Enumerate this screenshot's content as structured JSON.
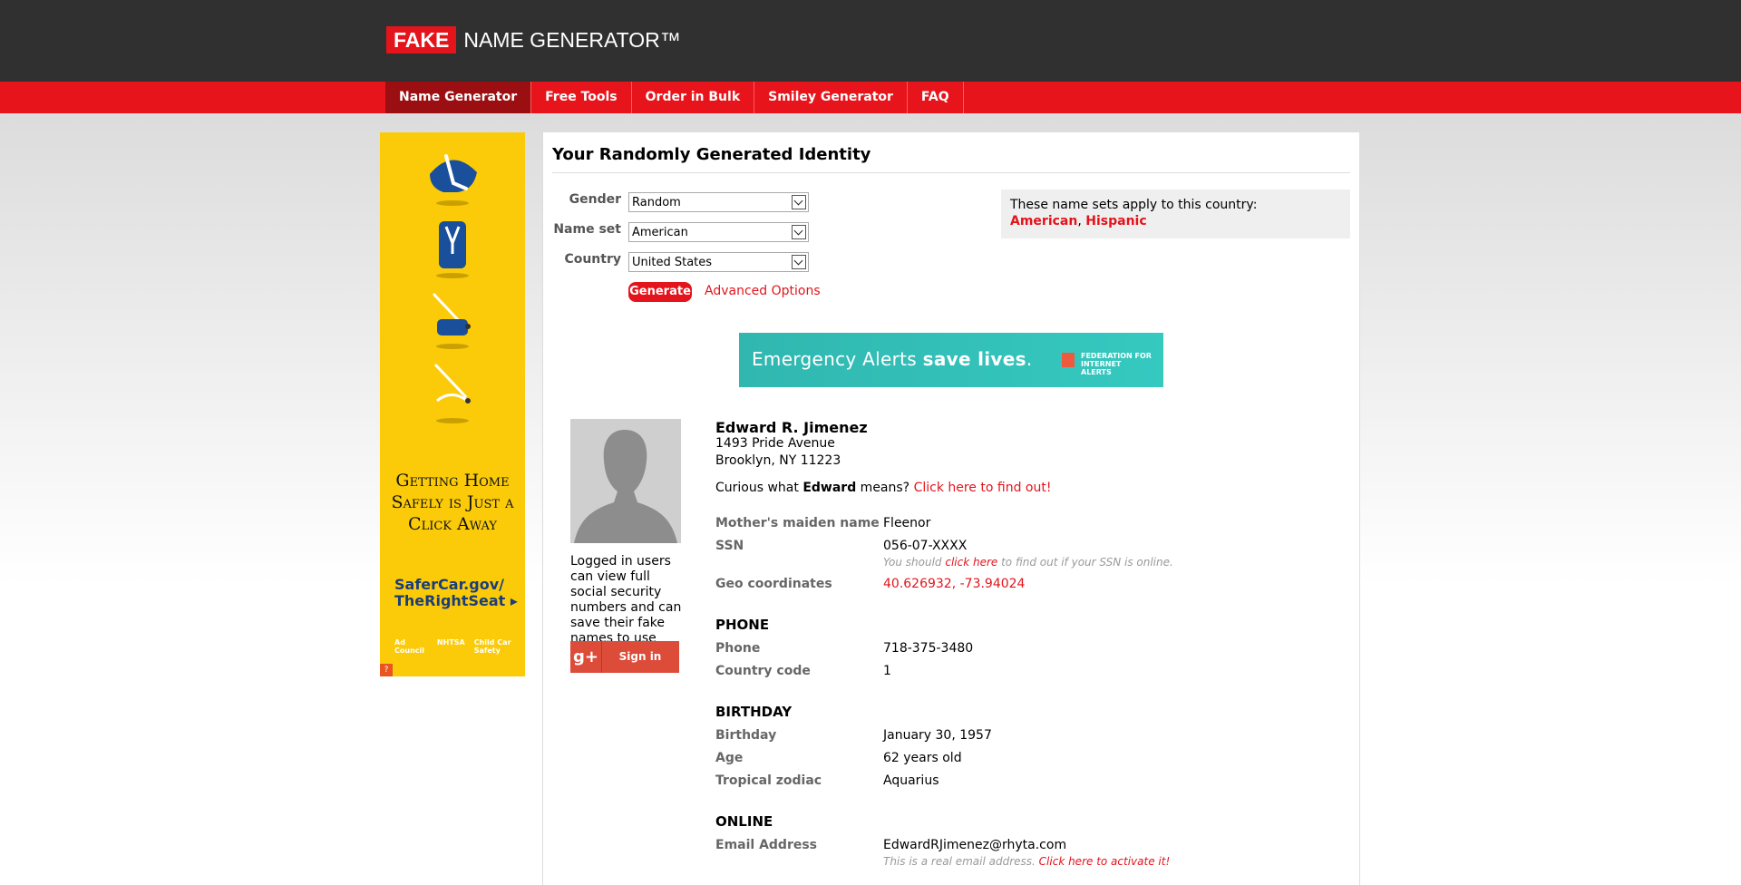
{
  "brand": {
    "fake": "FAKE",
    "rest": "NAME GENERATOR™"
  },
  "nav": [
    "Name Generator",
    "Free Tools",
    "Order in Bulk",
    "Smiley Generator",
    "FAQ"
  ],
  "ad": {
    "headline": "Getting Home Safely is Just a Click Away",
    "link": "SaferCar.gov/ TheRightSeat ▸",
    "logos": [
      "Ad Council",
      "NHTSA",
      "Child Car Safety"
    ],
    "corner": "?"
  },
  "main": {
    "title": "Your Randomly Generated Identity",
    "form": {
      "gender_label": "Gender",
      "gender_value": "Random",
      "nameset_label": "Name set",
      "nameset_value": "American",
      "country_label": "Country",
      "country_value": "United States",
      "generate": "Generate",
      "advanced": "Advanced Options"
    },
    "nameset_box": {
      "text": "These name sets apply to this country:",
      "link1": "American",
      "sep": ", ",
      "link2": "Hispanic"
    },
    "banner": {
      "light": "Emergency Alerts ",
      "bold": "save lives",
      "dot": ".",
      "org": "FEDERATION FOR INTERNET ALERTS"
    },
    "avatar_note": "Logged in users can view full social security numbers and can save their fake names to use later.",
    "signin": {
      "g": "g+",
      "label": "Sign in"
    }
  },
  "identity": {
    "name": "Edward R. Jimenez",
    "street": "1493 Pride Avenue",
    "city": "Brooklyn, NY 11223",
    "curious_pre": "Curious what ",
    "first": "Edward",
    "curious_mid": " means? ",
    "curious_link": "Click here to find out!",
    "maiden_label": "Mother's maiden name",
    "maiden": "Fleenor",
    "ssn_label": "SSN",
    "ssn": "056-07-XXXX",
    "ssn_note_pre": "You should ",
    "ssn_note_link": "click here",
    "ssn_note_post": " to find out if your SSN is online.",
    "geo_label": "Geo coordinates",
    "geo": "40.626932, -73.94024",
    "phone_section": "PHONE",
    "phone_label": "Phone",
    "phone": "718-375-3480",
    "cc_label": "Country code",
    "cc": "1",
    "birthday_section": "BIRTHDAY",
    "birthday_label": "Birthday",
    "birthday": "January 30, 1957",
    "age_label": "Age",
    "age": "62 years old",
    "zodiac_label": "Tropical zodiac",
    "zodiac": "Aquarius",
    "online_section": "ONLINE",
    "email_label": "Email Address",
    "email": "EdwardRJimenez@rhyta.com",
    "email_note_pre": "This is a real email address. ",
    "email_note_link": "Click here to activate it!"
  }
}
